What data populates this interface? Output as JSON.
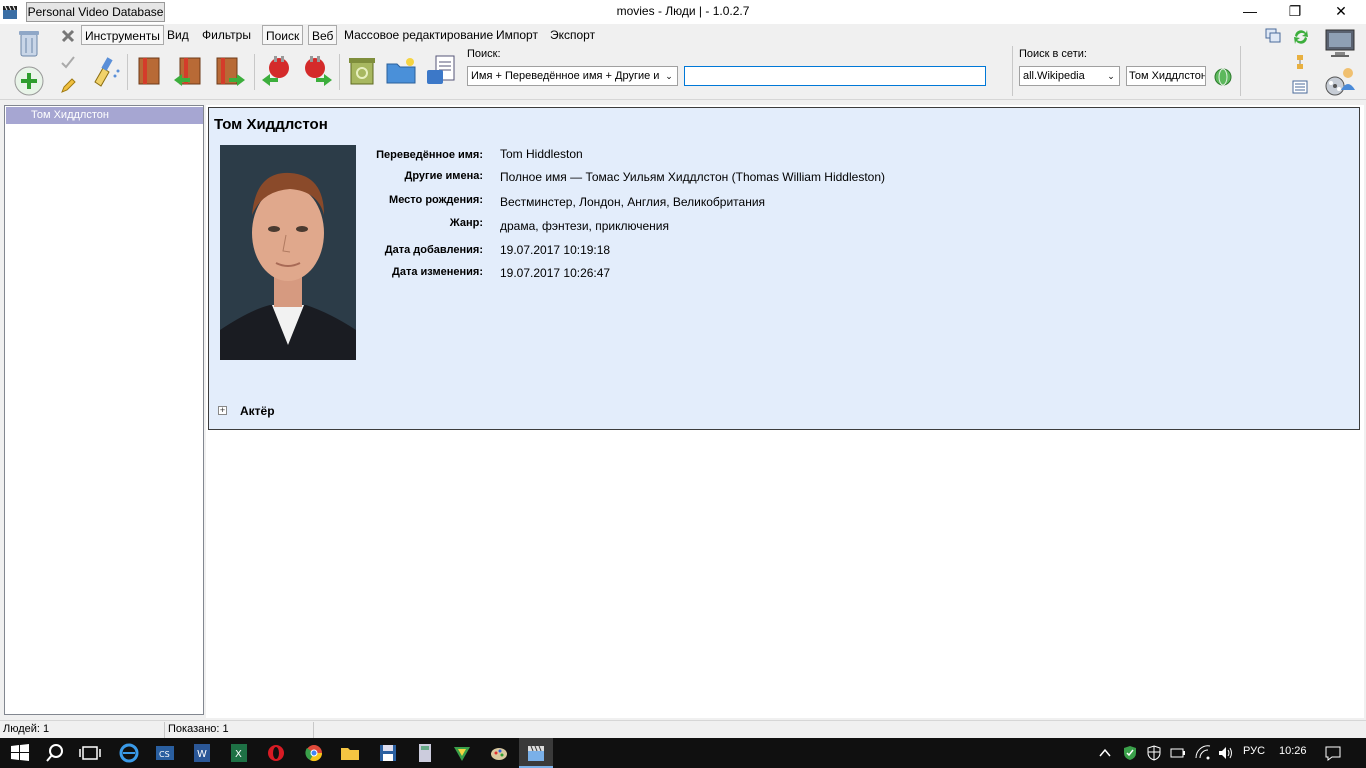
{
  "window": {
    "app_tab": "Personal Video Database",
    "title": "movies - Люди | - 1.0.2.7"
  },
  "menu": {
    "tools": "Инструменты",
    "view": "Вид",
    "filters": "Фильтры",
    "search": "Поиск",
    "web": "Веб",
    "mass_edit": "Массовое редактирование",
    "import": "Импорт",
    "export": "Экспорт"
  },
  "search": {
    "label": "Поиск:",
    "field_select": "Имя + Переведённое имя + Другие и",
    "query": ""
  },
  "net_search": {
    "label": "Поиск в сети:",
    "source": "all.Wikipedia",
    "query": "Том Хиддлстон"
  },
  "list": {
    "items": [
      "Том Хиддлстон"
    ]
  },
  "person": {
    "name": "Том Хиддлстон",
    "fields": [
      {
        "label": "Переведённое имя:",
        "value": "Tom Hiddleston"
      },
      {
        "label": "Другие имена:",
        "value": "Полное имя — Томас Уильям Хиддлстон (Thomas William Hiddleston)"
      },
      {
        "label": "Место рождения:",
        "value": "Вестминстер, Лондон, Англия, Великобритания"
      },
      {
        "label": "Жанр:",
        "value": "драма, фэнтези, приключения"
      },
      {
        "label": "Дата добавления:",
        "value": "19.07.2017 10:19:18"
      },
      {
        "label": "Дата изменения:",
        "value": "19.07.2017 10:26:47"
      }
    ],
    "role_section": "Актёр"
  },
  "status": {
    "people": "Людей: 1",
    "shown": "Показано: 1"
  },
  "taskbar": {
    "lang": "РУС",
    "time": "10:26"
  }
}
